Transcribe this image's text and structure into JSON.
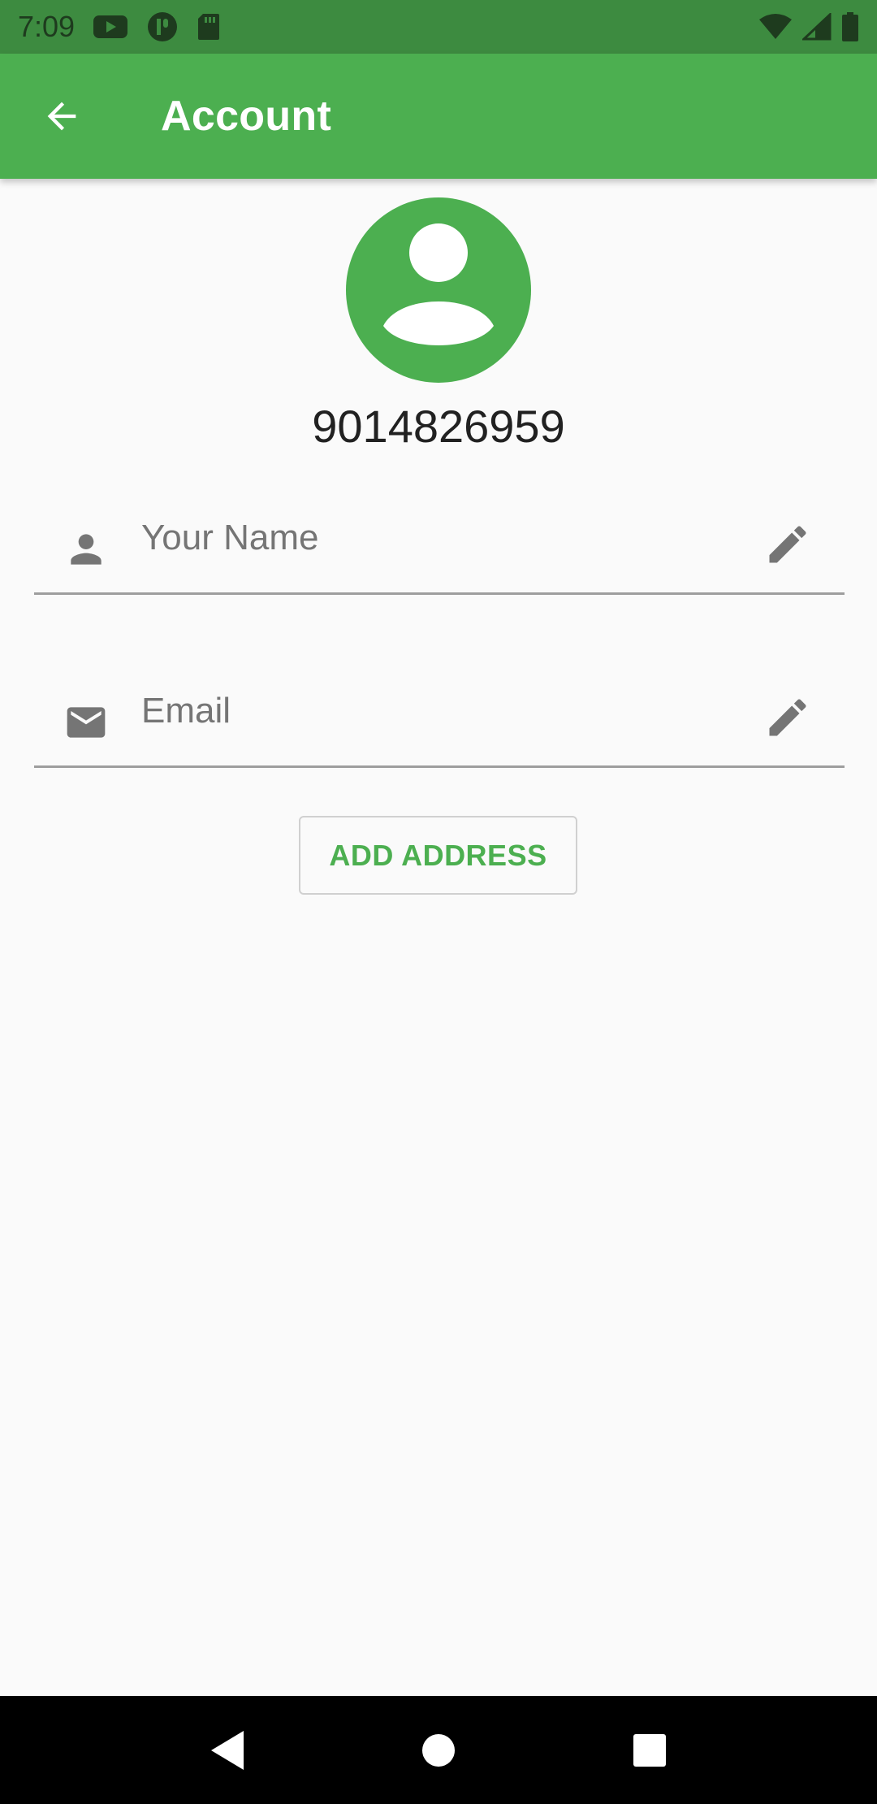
{
  "status_bar": {
    "time": "7:09",
    "notification_icons": [
      "youtube-icon",
      "app-icon",
      "sd-card-icon"
    ],
    "system_icons": [
      "wifi-icon",
      "signal-icon",
      "battery-icon"
    ]
  },
  "app_bar": {
    "back_icon": "arrow-back-icon",
    "title": "Account",
    "background_color": "#4caf50"
  },
  "profile": {
    "avatar_icon": "account-circle-icon",
    "avatar_color": "#4caf50",
    "phone_number": "9014826959"
  },
  "form": {
    "name_field": {
      "icon": "person-icon",
      "placeholder": "Your Name",
      "value": "",
      "edit_icon": "pencil-icon"
    },
    "email_field": {
      "icon": "mail-icon",
      "placeholder": "Email",
      "value": "",
      "edit_icon": "pencil-icon"
    },
    "add_address_label": "ADD ADDRESS",
    "accent_color": "#4caf50"
  },
  "nav_bar": {
    "buttons": [
      "back-triangle-icon",
      "home-circle-icon",
      "recents-square-icon"
    ]
  }
}
